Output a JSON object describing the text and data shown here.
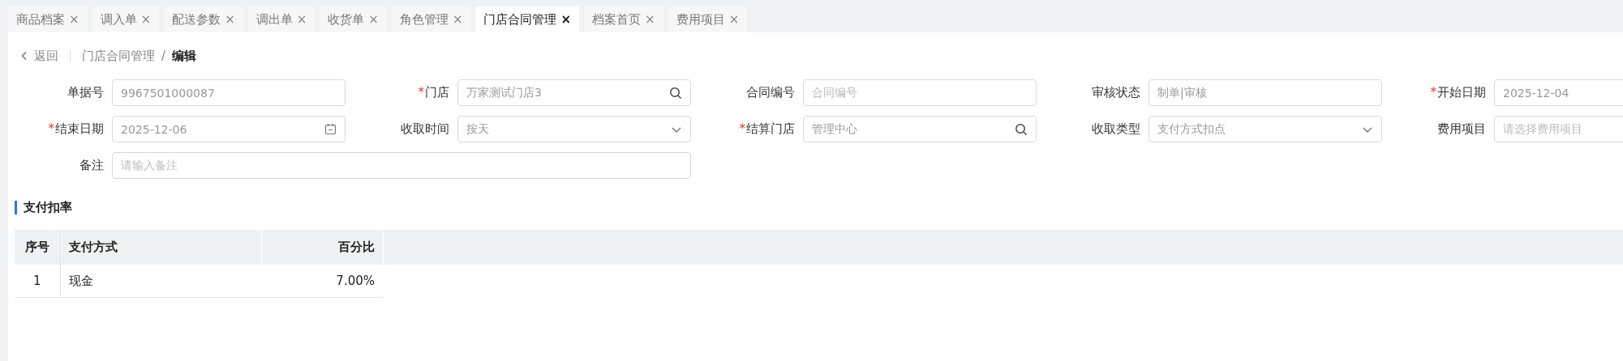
{
  "tabs": [
    {
      "label": "商品档案",
      "close": "×",
      "selected": false
    },
    {
      "label": "调入单",
      "close": "×",
      "selected": false
    },
    {
      "label": "配送参数",
      "close": "×",
      "selected": false
    },
    {
      "label": "调出单",
      "close": "×",
      "selected": false
    },
    {
      "label": "收货单",
      "close": "×",
      "selected": false
    },
    {
      "label": "角色管理",
      "close": "×",
      "selected": false
    },
    {
      "label": "门店合同管理",
      "close": "×",
      "selected": true
    },
    {
      "label": "档案首页",
      "close": "×",
      "selected": false
    },
    {
      "label": "费用项目",
      "close": "×",
      "selected": false
    }
  ],
  "breadcrumb": {
    "back": "返回",
    "path": "门店合同管理",
    "separator": "/",
    "current": "编辑"
  },
  "required_mark": "*",
  "fields": [
    {
      "label": "单据号",
      "required": false,
      "kind": "text",
      "value": "9967501000087"
    },
    {
      "label": "门店",
      "required": true,
      "kind": "search",
      "value": "万家测试门店3"
    },
    {
      "label": "合同编号",
      "required": false,
      "kind": "text",
      "placeholder": "合同编号"
    },
    {
      "label": "审核状态",
      "required": false,
      "kind": "text",
      "value": "制单|审核"
    },
    {
      "label": "开始日期",
      "required": true,
      "kind": "date-cut",
      "value": "2025-12-04"
    },
    {
      "label": "结束日期",
      "required": true,
      "kind": "date",
      "value": "2025-12-06"
    },
    {
      "label": "收取时间",
      "required": false,
      "kind": "select",
      "value": "按天"
    },
    {
      "label": "结算门店",
      "required": true,
      "kind": "search",
      "value": "管理中心"
    },
    {
      "label": "收取类型",
      "required": false,
      "kind": "select",
      "value": "支付方式扣点"
    },
    {
      "label": "费用项目",
      "required": false,
      "kind": "text",
      "placeholder": "请选择费用项目"
    },
    {
      "label": "备注",
      "required": false,
      "kind": "wide",
      "placeholder": "请输入备注"
    }
  ],
  "section_title": "支付扣率",
  "table": {
    "columns": [
      "序号",
      "支付方式",
      "百分比"
    ],
    "rows": [
      [
        "1",
        "现金",
        "7.00%"
      ]
    ]
  }
}
